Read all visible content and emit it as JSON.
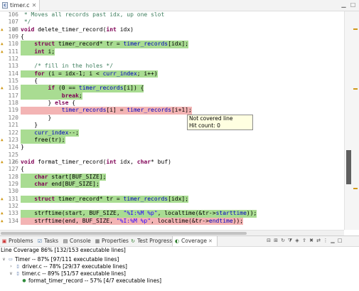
{
  "editor": {
    "tab_title": "timer.c",
    "lines": [
      {
        "n": "106",
        "hl": "",
        "warn": false,
        "fold": "",
        "segs": [
          [
            "cm",
            " * Moves all records past idx, up one slot"
          ]
        ]
      },
      {
        "n": "107",
        "hl": "",
        "warn": false,
        "fold": "",
        "segs": [
          [
            "cm",
            " */"
          ]
        ]
      },
      {
        "n": "108",
        "hl": "",
        "warn": true,
        "fold": "⊖",
        "segs": [
          [
            "kw",
            "void"
          ],
          [
            "",
            " delete_timer_record("
          ],
          [
            "kw",
            "int"
          ],
          [
            "",
            " idx)"
          ]
        ]
      },
      {
        "n": "109",
        "hl": "",
        "warn": false,
        "fold": "",
        "segs": [
          [
            "",
            "{"
          ]
        ]
      },
      {
        "n": "110",
        "hl": "green",
        "warn": true,
        "fold": "",
        "segs": [
          [
            "",
            "    "
          ],
          [
            "kw",
            "struct"
          ],
          [
            "",
            " timer_record* tr = "
          ],
          [
            "fld",
            "timer_records"
          ],
          [
            "",
            "[idx];"
          ]
        ]
      },
      {
        "n": "111",
        "hl": "green",
        "warn": true,
        "fold": "",
        "segs": [
          [
            "",
            "    "
          ],
          [
            "kw",
            "int"
          ],
          [
            "",
            " i;"
          ]
        ]
      },
      {
        "n": "112",
        "hl": "",
        "warn": false,
        "fold": "",
        "segs": [
          [
            "",
            ""
          ]
        ]
      },
      {
        "n": "113",
        "hl": "",
        "warn": false,
        "fold": "",
        "segs": [
          [
            "",
            "    "
          ],
          [
            "cm",
            "/* fill in the holes */"
          ]
        ]
      },
      {
        "n": "114",
        "hl": "green",
        "warn": false,
        "fold": "",
        "segs": [
          [
            "",
            "    "
          ],
          [
            "kw",
            "for"
          ],
          [
            "",
            " (i = idx-1; i < "
          ],
          [
            "fld",
            "curr_index"
          ],
          [
            "",
            "; i++)"
          ]
        ]
      },
      {
        "n": "115",
        "hl": "",
        "warn": false,
        "fold": "",
        "segs": [
          [
            "",
            "    {"
          ]
        ]
      },
      {
        "n": "116",
        "hl": "green",
        "warn": true,
        "fold": "",
        "segs": [
          [
            "",
            "        "
          ],
          [
            "kw",
            "if"
          ],
          [
            "",
            " (0 == "
          ],
          [
            "fld",
            "timer_records"
          ],
          [
            "",
            "[i]) {"
          ]
        ]
      },
      {
        "n": "117",
        "hl": "green",
        "warn": false,
        "fold": "",
        "segs": [
          [
            "",
            "            "
          ],
          [
            "kw",
            "break"
          ],
          [
            "",
            ";"
          ]
        ]
      },
      {
        "n": "118",
        "hl": "",
        "warn": false,
        "fold": "",
        "segs": [
          [
            "",
            "        } "
          ],
          [
            "kw",
            "else"
          ],
          [
            "",
            " {"
          ]
        ]
      },
      {
        "n": "119",
        "hl": "red",
        "warn": false,
        "fold": "",
        "segs": [
          [
            "",
            "            "
          ],
          [
            "fld",
            "timer_records"
          ],
          [
            "",
            "[i] = "
          ],
          [
            "fld",
            "timer_records"
          ],
          [
            "",
            "[i+1];"
          ]
        ]
      },
      {
        "n": "120",
        "hl": "",
        "warn": false,
        "fold": "",
        "segs": [
          [
            "",
            "        }"
          ]
        ]
      },
      {
        "n": "121",
        "hl": "",
        "warn": false,
        "fold": "",
        "segs": [
          [
            "",
            "    }"
          ]
        ]
      },
      {
        "n": "122",
        "hl": "green",
        "warn": false,
        "fold": "",
        "segs": [
          [
            "",
            "    "
          ],
          [
            "fld",
            "curr_index"
          ],
          [
            "",
            "--;"
          ]
        ]
      },
      {
        "n": "123",
        "hl": "green",
        "warn": true,
        "fold": "",
        "segs": [
          [
            "",
            "    free(tr);"
          ]
        ]
      },
      {
        "n": "124",
        "hl": "",
        "warn": false,
        "fold": "",
        "segs": [
          [
            "",
            "}"
          ]
        ]
      },
      {
        "n": "125",
        "hl": "",
        "warn": false,
        "fold": "",
        "segs": [
          [
            "",
            ""
          ]
        ]
      },
      {
        "n": "126",
        "hl": "",
        "warn": true,
        "fold": "⊖",
        "segs": [
          [
            "kw",
            "void"
          ],
          [
            "",
            " format_timer_record("
          ],
          [
            "kw",
            "int"
          ],
          [
            "",
            " idx, "
          ],
          [
            "kw",
            "char"
          ],
          [
            "",
            "* buf)"
          ]
        ]
      },
      {
        "n": "127",
        "hl": "",
        "warn": false,
        "fold": "",
        "segs": [
          [
            "",
            "{"
          ]
        ]
      },
      {
        "n": "128",
        "hl": "green",
        "warn": false,
        "fold": "",
        "segs": [
          [
            "",
            "    "
          ],
          [
            "kw",
            "char"
          ],
          [
            "",
            " start[BUF_SIZE];"
          ]
        ]
      },
      {
        "n": "129",
        "hl": "green",
        "warn": false,
        "fold": "",
        "segs": [
          [
            "",
            "    "
          ],
          [
            "kw",
            "char"
          ],
          [
            "",
            " end[BUF_SIZE];"
          ]
        ]
      },
      {
        "n": "130",
        "hl": "",
        "warn": false,
        "fold": "",
        "segs": [
          [
            "",
            ""
          ]
        ]
      },
      {
        "n": "131",
        "hl": "green",
        "warn": true,
        "fold": "",
        "segs": [
          [
            "",
            "    "
          ],
          [
            "kw",
            "struct"
          ],
          [
            "",
            " timer_record* tr = "
          ],
          [
            "fld",
            "timer_records"
          ],
          [
            "",
            "[idx];"
          ]
        ]
      },
      {
        "n": "132",
        "hl": "",
        "warn": false,
        "fold": "",
        "segs": [
          [
            "",
            ""
          ]
        ]
      },
      {
        "n": "133",
        "hl": "green",
        "warn": true,
        "fold": "",
        "segs": [
          [
            "",
            "    strftime(start, BUF_SIZE, "
          ],
          [
            "st",
            "\"%I:%M %p\""
          ],
          [
            "",
            ", localtime(&tr->"
          ],
          [
            "fld",
            "starttime"
          ],
          [
            "",
            "));"
          ]
        ]
      },
      {
        "n": "134",
        "hl": "red",
        "warn": true,
        "fold": "",
        "segs": [
          [
            "",
            "    strftime(end, BUF_SIZE, "
          ],
          [
            "st",
            "\"%I:%M %p\""
          ],
          [
            "",
            ", localtime(&tr->"
          ],
          [
            "fld",
            "endtime"
          ],
          [
            "",
            "));"
          ]
        ]
      }
    ],
    "tooltip": {
      "line1": "Not covered line",
      "line2": "Hit count: 0"
    }
  },
  "colors": {
    "covered": "#a9dc92",
    "not_covered": "#f3b4b4"
  },
  "views": {
    "tabs": [
      "Problems",
      "Tasks",
      "Console",
      "Properties",
      "Test Progress",
      "Coverage"
    ],
    "icons": [
      "problems-icon",
      "tasks-icon",
      "console-icon",
      "properties-icon",
      "test-progress-icon",
      "coverage-icon"
    ],
    "active": "Coverage"
  },
  "coverage": {
    "summary": "Line Coverage 86% [132/153 executable lines]",
    "tree": [
      {
        "label": "Timer -- 87% [97/111 executable lines]",
        "level": 0,
        "twist": "expanded"
      },
      {
        "label": "driver.c -- 78% [29/37 executable lines]",
        "level": 1,
        "twist": "collapsed"
      },
      {
        "label": "timer.c -- 89% [51/57 executable lines]",
        "level": 1,
        "twist": "expanded"
      },
      {
        "label": "format_timer_record -- 57% [4/7 executable lines]",
        "level": 2,
        "twist": "none"
      }
    ]
  }
}
